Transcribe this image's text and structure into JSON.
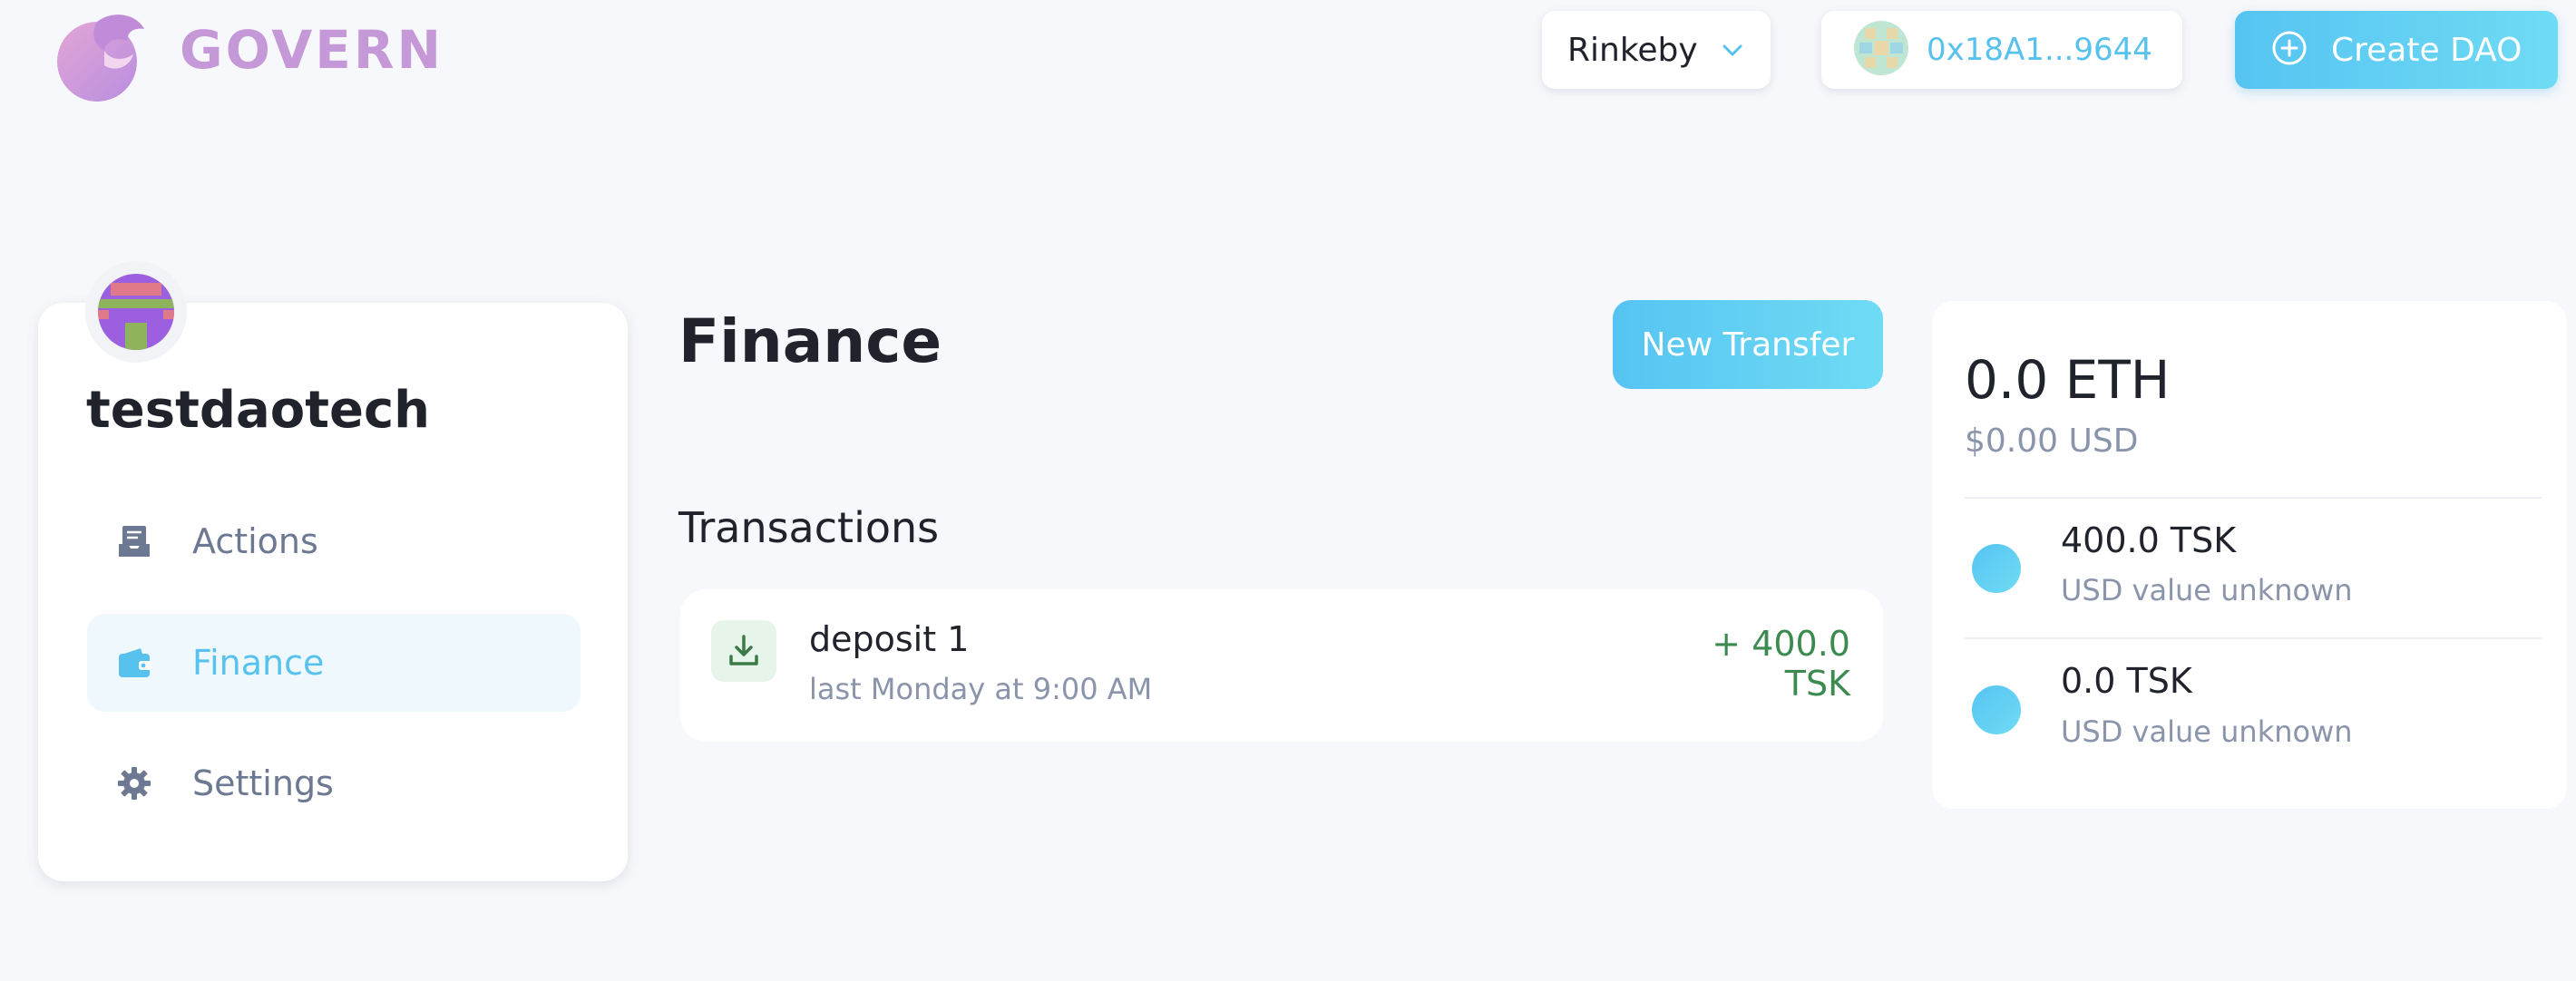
{
  "header": {
    "brand": "GOVERN",
    "network": "Rinkeby",
    "account_address": "0x18A1...9644",
    "create_dao_label": "Create DAO"
  },
  "sidebar": {
    "dao_name": "testdaotech",
    "items": [
      {
        "label": "Actions",
        "icon": "inbox-icon",
        "active": false
      },
      {
        "label": "Finance",
        "icon": "wallet-icon",
        "active": true
      },
      {
        "label": "Settings",
        "icon": "gear-icon",
        "active": false
      }
    ]
  },
  "main": {
    "title": "Finance",
    "new_transfer_label": "New Transfer",
    "transactions_title": "Transactions",
    "transactions": [
      {
        "title": "deposit 1",
        "time": "last Monday at 9:00 AM",
        "amount": "+ 400.0 TSK",
        "icon": "download-icon"
      }
    ]
  },
  "balance": {
    "eth": "0.0 ETH",
    "eth_usd": "$0.00 USD",
    "tokens": [
      {
        "amount": "400.0 TSK",
        "usd": "USD value unknown"
      },
      {
        "amount": "0.0 TSK",
        "usd": "USD value unknown"
      }
    ]
  },
  "colors": {
    "accent": "#58c2ef",
    "brand": "#c598d8",
    "positive": "#3b8a4f",
    "background": "#f7f8fb"
  }
}
